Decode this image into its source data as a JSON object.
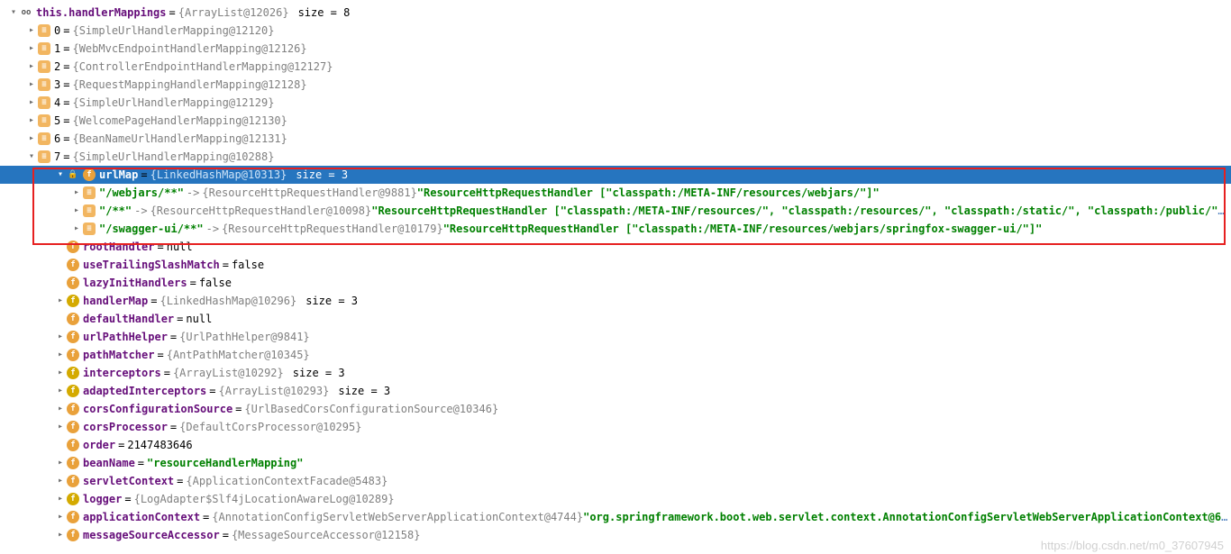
{
  "root": {
    "field": "this.handlerMappings",
    "type": "{ArrayList@12026}",
    "size": "size = 8"
  },
  "items": [
    {
      "key": "0",
      "type": "{SimpleUrlHandlerMapping@12120}"
    },
    {
      "key": "1",
      "type": "{WebMvcEndpointHandlerMapping@12126}"
    },
    {
      "key": "2",
      "type": "{ControllerEndpointHandlerMapping@12127}"
    },
    {
      "key": "3",
      "type": "{RequestMappingHandlerMapping@12128}"
    },
    {
      "key": "4",
      "type": "{SimpleUrlHandlerMapping@12129}"
    },
    {
      "key": "5",
      "type": "{WelcomePageHandlerMapping@12130}"
    },
    {
      "key": "6",
      "type": "{BeanNameUrlHandlerMapping@12131}"
    },
    {
      "key": "7",
      "type": "{SimpleUrlHandlerMapping@10288}"
    }
  ],
  "urlMap": {
    "field": "urlMap",
    "type": "{LinkedHashMap@10313}",
    "size": "size = 3",
    "entries": [
      {
        "key": "\"/webjars/**\"",
        "type": "{ResourceHttpRequestHandler@9881}",
        "value": "\"ResourceHttpRequestHandler [\"classpath:/META-INF/resources/webjars/\"]\""
      },
      {
        "key": "\"/**\"",
        "type": "{ResourceHttpRequestHandler@10098}",
        "value": "\"ResourceHttpRequestHandler [\"classpath:/META-INF/resources/\", \"classpath:/resources/\", \"classpath:/static/\", \"classpath:/public/\"",
        "viewMore": "… View"
      },
      {
        "key": "\"/swagger-ui/**\"",
        "type": "{ResourceHttpRequestHandler@10179}",
        "value": "\"ResourceHttpRequestHandler [\"classpath:/META-INF/resources/webjars/springfox-swagger-ui/\"]\""
      }
    ]
  },
  "fields": [
    {
      "name": "rootHandler",
      "eq": "=",
      "val": "null",
      "iconStyle": "f-orange"
    },
    {
      "name": "useTrailingSlashMatch",
      "eq": "=",
      "val": "false",
      "iconStyle": "f-orange"
    },
    {
      "name": "lazyInitHandlers",
      "eq": "=",
      "val": "false",
      "iconStyle": "f-orange"
    },
    {
      "name": "handlerMap",
      "eq": "=",
      "type": "{LinkedHashMap@10296}",
      "size": "size = 3",
      "iconStyle": "f-gold",
      "arrow": true
    },
    {
      "name": "defaultHandler",
      "eq": "=",
      "val": "null",
      "iconStyle": "f-orange"
    },
    {
      "name": "urlPathHelper",
      "eq": "=",
      "type": "{UrlPathHelper@9841}",
      "iconStyle": "f-orange",
      "arrow": true
    },
    {
      "name": "pathMatcher",
      "eq": "=",
      "type": "{AntPathMatcher@10345}",
      "iconStyle": "f-orange",
      "arrow": true
    },
    {
      "name": "interceptors",
      "eq": "=",
      "type": "{ArrayList@10292}",
      "size": "size = 3",
      "iconStyle": "f-gold",
      "arrow": true
    },
    {
      "name": "adaptedInterceptors",
      "eq": "=",
      "type": "{ArrayList@10293}",
      "size": "size = 3",
      "iconStyle": "f-gold",
      "arrow": true
    },
    {
      "name": "corsConfigurationSource",
      "eq": "=",
      "type": "{UrlBasedCorsConfigurationSource@10346}",
      "iconStyle": "f-orange",
      "arrow": true
    },
    {
      "name": "corsProcessor",
      "eq": "=",
      "type": "{DefaultCorsProcessor@10295}",
      "iconStyle": "f-orange",
      "arrow": true
    },
    {
      "name": "order",
      "eq": "=",
      "val": "2147483646",
      "iconStyle": "f-orange"
    },
    {
      "name": "beanName",
      "eq": "=",
      "str": "\"resourceHandlerMapping\"",
      "iconStyle": "f-orange",
      "arrow": true
    },
    {
      "name": "servletContext",
      "eq": "=",
      "type": "{ApplicationContextFacade@5483}",
      "iconStyle": "f-orange",
      "arrow": true
    },
    {
      "name": "logger",
      "eq": "=",
      "type": "{LogAdapter$Slf4jLocationAwareLog@10289}",
      "iconStyle": "f-gold",
      "arrow": true
    },
    {
      "name": "applicationContext",
      "eq": "=",
      "type": "{AnnotationConfigServletWebServerApplicationContext@4744}",
      "quoted": "\"org.springframework.boot.web.servlet.context.AnnotationConfigServletWebServerApplicationContext@6",
      "viewMore": "… View",
      "iconStyle": "f-orange",
      "arrow": true
    },
    {
      "name": "messageSourceAccessor",
      "eq": "=",
      "type": "{MessageSourceAccessor@12158}",
      "iconStyle": "f-orange",
      "arrow": true
    }
  ],
  "watermark": "https://blog.csdn.net/m0_37607945"
}
